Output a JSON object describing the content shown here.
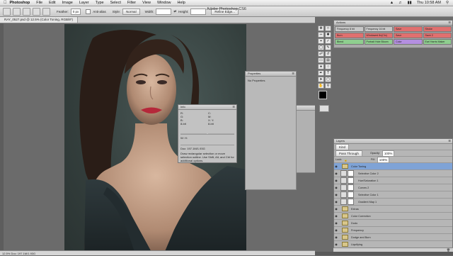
{
  "menubar": {
    "apple": "",
    "app": "Photoshop",
    "items": [
      "File",
      "Edit",
      "Image",
      "Layer",
      "Type",
      "Select",
      "Filter",
      "View",
      "Window",
      "Help"
    ],
    "time": "Thu 10:58 AM"
  },
  "window_title": "Adobe Photoshop CS6",
  "optbar": {
    "feather_label": "Feather:",
    "feather_value": "0 px",
    "antialias_label": "Anti-alias",
    "style_label": "Style:",
    "style_value": "Normal",
    "width_label": "Width:",
    "height_label": "Height:",
    "refine_edge": "Refine Edge..."
  },
  "document": {
    "tab": "RAY_0527.psd @ 12.5% (Color Toning, RGB/8*)",
    "status": "12.5%     Doc: 197.1M/1.93G"
  },
  "properties": {
    "title": "Properties",
    "body": "No Properties"
  },
  "info": {
    "title": "Info",
    "r": "R:",
    "g": "G:",
    "b": "B:",
    "c": "C:",
    "m": "M:",
    "x": "X:",
    "y": "Y:",
    "w": "W:",
    "h": "H:",
    "values_a": "8-bit",
    "values_b": "8-bit",
    "doc": "Doc: 197.1M/1.93G",
    "hint": "Draw rectangular selection or move selection outline. Use Shift, Alt, and Ctrl for additional options."
  },
  "actions": {
    "title": "Actions",
    "items": [
      {
        "label": "Frequency 8 bit",
        "color": "#c8c8c8"
      },
      {
        "label": "Frequency 16 bit",
        "color": "#c8c8c8"
      },
      {
        "label": "Save",
        "color": "#e0706f"
      },
      {
        "label": "Stroke",
        "color": "#e0706f"
      },
      {
        "label": "Burn",
        "color": "#e0706f"
      },
      {
        "label": "Windowed 8x(Clo)",
        "color": "#e0706f"
      },
      {
        "label": "Save",
        "color": "#e0706f"
      },
      {
        "label": "Save 2",
        "color": "#e0706f"
      },
      {
        "label": "Blend",
        "color": "#8fce8f"
      },
      {
        "label": "Portrait Hole Bloom",
        "color": "#8fce8f"
      },
      {
        "label": "Color",
        "color": "#b48fe0"
      },
      {
        "label": "Earl Harris Maker",
        "color": "#8fce8f"
      }
    ]
  },
  "layers": {
    "title": "Layers",
    "filter_label": "Kind",
    "blend_mode": "Pass Through",
    "opacity_label": "Opacity:",
    "opacity_value": "100%",
    "lock_label": "Lock:",
    "fill_label": "Fill:",
    "fill_value": "100%",
    "rows": [
      {
        "name": "Color Toning",
        "type": "group-open",
        "selected": true
      },
      {
        "name": "Selective Color 2",
        "type": "adj"
      },
      {
        "name": "Hue/Saturation 1",
        "type": "adj"
      },
      {
        "name": "Curves 2",
        "type": "adj"
      },
      {
        "name": "Selective Color 1",
        "type": "adj"
      },
      {
        "name": "Gradient Map 1",
        "type": "adj"
      },
      {
        "name": "Extras",
        "type": "group"
      },
      {
        "name": "Color Correction",
        "type": "group"
      },
      {
        "name": "Dodo",
        "type": "group"
      },
      {
        "name": "Frequency",
        "type": "group"
      },
      {
        "name": "Dodge and Burn",
        "type": "group"
      },
      {
        "name": "Liquifying",
        "type": "group"
      }
    ]
  }
}
